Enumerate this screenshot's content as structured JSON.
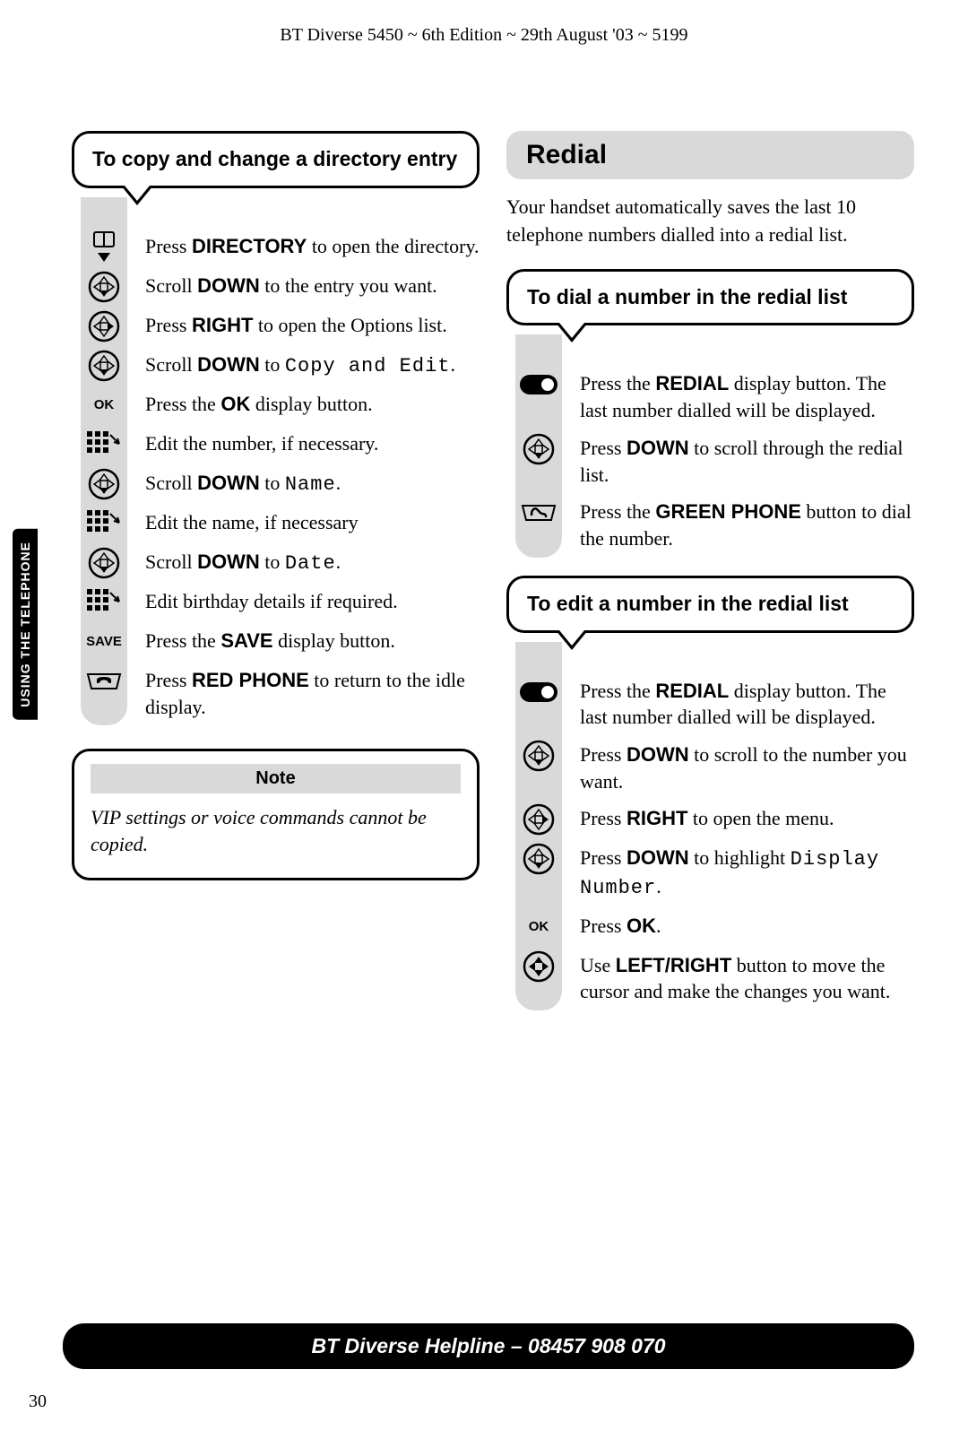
{
  "header": "BT Diverse 5450 ~ 6th Edition ~ 29th August '03 ~ 5199",
  "side_tab": "USING THE TELEPHONE",
  "left": {
    "callout_title": "To copy and change a directory entry",
    "steps": [
      {
        "icon": "book-down",
        "text_pre": "Press ",
        "bold": "DIRECTORY",
        "text_post": " to open the directory."
      },
      {
        "icon": "nav-down",
        "text_pre": "Scroll ",
        "bold": "DOWN",
        "text_post": " to the entry you want."
      },
      {
        "icon": "nav-right",
        "text_pre": "Press ",
        "bold": "RIGHT",
        "text_post": " to open the Options list."
      },
      {
        "icon": "nav-down",
        "text_pre": "Scroll ",
        "bold": "DOWN",
        "text_post": " to ",
        "lcd": "Copy and Edit",
        "tail": "."
      },
      {
        "icon": "label",
        "label": "OK",
        "text_pre": "Press the ",
        "bold": "OK",
        "text_post": " display button."
      },
      {
        "icon": "keypad",
        "text_pre": "Edit the number, if necessary."
      },
      {
        "icon": "nav-down",
        "text_pre": "Scroll ",
        "bold": "DOWN",
        "text_post": " to ",
        "lcd": "Name",
        "tail": "."
      },
      {
        "icon": "keypad",
        "text_pre": "Edit the name, if necessary"
      },
      {
        "icon": "nav-down",
        "text_pre": "Scroll ",
        "bold": "DOWN",
        "text_post": " to ",
        "lcd": "Date",
        "tail": "."
      },
      {
        "icon": "keypad",
        "text_pre": "Edit birthday details if required."
      },
      {
        "icon": "label",
        "label": "SAVE",
        "text_pre": "Press the ",
        "bold": "SAVE",
        "text_post": " display button."
      },
      {
        "icon": "red-phone",
        "text_pre": "Press ",
        "bold": "RED PHONE",
        "text_post": " to return to the idle display."
      }
    ],
    "note_title": "Note",
    "note_body": "VIP settings or voice commands cannot be copied."
  },
  "right": {
    "section_title": "Redial",
    "intro": "Your handset automatically saves the last 10 telephone numbers dialled into a redial list.",
    "block1": {
      "callout_title": "To dial a number in the redial list",
      "steps": [
        {
          "icon": "redial",
          "text_pre": "Press the ",
          "bold": "REDIAL",
          "text_post": " display button. The last number dialled will be displayed."
        },
        {
          "icon": "nav-down",
          "text_pre": "Press ",
          "bold": "DOWN",
          "text_post": " to scroll through the redial list."
        },
        {
          "icon": "green-phone",
          "text_pre": "Press the ",
          "bold": "GREEN PHONE",
          "text_post": " button to dial the number."
        }
      ]
    },
    "block2": {
      "callout_title": "To edit a number in the redial list",
      "steps": [
        {
          "icon": "redial",
          "text_pre": "Press the ",
          "bold": "REDIAL",
          "text_post": " display button. The last number dialled will be displayed."
        },
        {
          "icon": "nav-down",
          "text_pre": "Press ",
          "bold": "DOWN",
          "text_post": " to scroll to the number you want."
        },
        {
          "icon": "nav-right",
          "text_pre": "Press ",
          "bold": "RIGHT",
          "text_post": " to open the menu."
        },
        {
          "icon": "nav-down",
          "text_pre": "Press ",
          "bold": "DOWN",
          "text_post": " to highlight ",
          "lcd": "Display Number",
          "tail": "."
        },
        {
          "icon": "label",
          "label": "OK",
          "text_pre": "Press ",
          "bold": "OK",
          "text_post": "."
        },
        {
          "icon": "nav-all",
          "text_pre": "Use ",
          "bold": "LEFT/RIGHT",
          "text_post": " button to move the cursor and make the changes you want."
        }
      ]
    }
  },
  "footer": "BT Diverse Helpline – 08457 908 070",
  "page_number": "30"
}
